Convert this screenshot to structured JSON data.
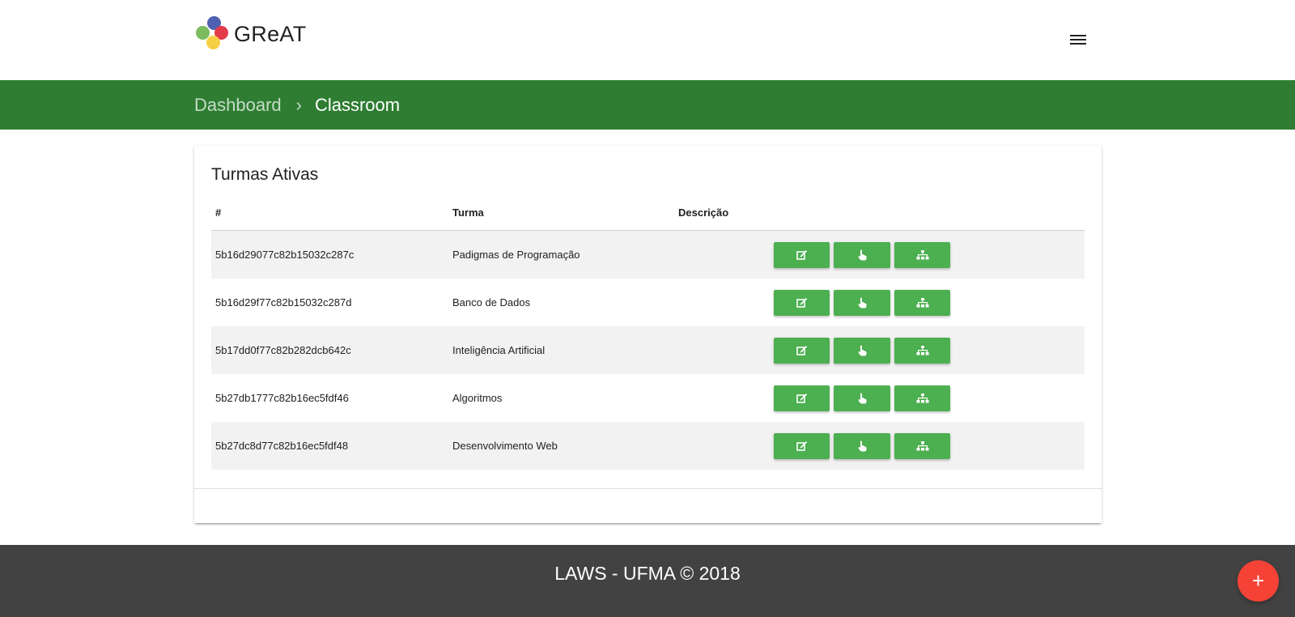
{
  "header": {
    "logo_text": "GReAT",
    "logo_colors": [
      "#4e60b0",
      "#7cbb5f",
      "#e23b4a",
      "#f5cf46"
    ],
    "menu_icon": "hamburger-menu-icon"
  },
  "breadcrumb": {
    "items": [
      "Dashboard",
      "Classroom"
    ],
    "separator": "›"
  },
  "card": {
    "title": "Turmas Ativas",
    "columns": [
      "#",
      "Turma",
      "Descrição",
      ""
    ],
    "rows": [
      {
        "id": "5b16d29077c82b15032c287c",
        "turma": "Padigmas de Programação",
        "descricao": ""
      },
      {
        "id": "5b16d29f77c82b15032c287d",
        "turma": "Banco de Dados",
        "descricao": ""
      },
      {
        "id": "5b17dd0f77c82b282dcb642c",
        "turma": "Inteligência Artificial",
        "descricao": ""
      },
      {
        "id": "5b27db1777c82b16ec5fdf46",
        "turma": "Algoritmos",
        "descricao": ""
      },
      {
        "id": "5b27dc8d77c82b16ec5fdf48",
        "turma": "Desenvolvimento Web",
        "descricao": ""
      }
    ],
    "actions": [
      "edit-icon",
      "pointer-hand-icon",
      "hierarchy-icon"
    ]
  },
  "footer": {
    "text": "LAWS - UFMA © 2018"
  },
  "fab": {
    "label": "+",
    "icon": "plus-icon"
  },
  "colors": {
    "primary_dark": "#2e7d32",
    "button_green": "#4caf50",
    "footer_bg": "#424242",
    "fab_red": "#f44336"
  }
}
